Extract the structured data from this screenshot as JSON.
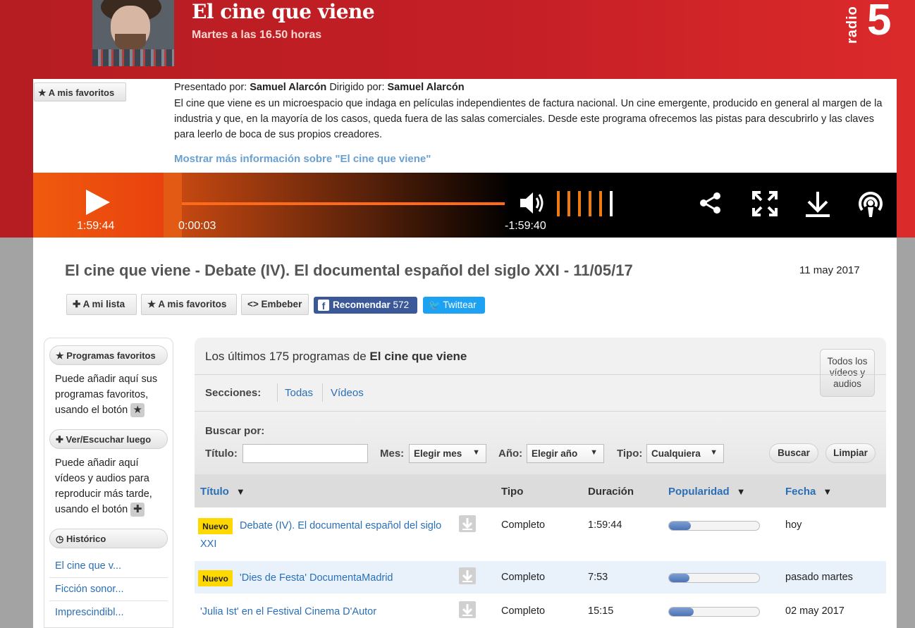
{
  "header": {
    "program_title": "El cine que viene",
    "schedule": "Martes a las 16.50 horas",
    "station_label": "radio",
    "station_number": "5"
  },
  "info": {
    "favorites_button": "A mis favoritos",
    "presented_by_label": "Presentado por:",
    "presenter": "Samuel Alarcón",
    "directed_by_label": "Dirigido por:",
    "director": "Samuel Alarcón",
    "description": "El cine que viene es un microespacio que indaga en películas independientes de factura nacional. Un cine emergente, producido en general al margen de la industria y que, en la mayoría de los casos, queda fuera de las salas comerciales. Desde este programa ofrecemos las pistas para descubrirlo y las claves para leerlo de boca de sus propios creadores.",
    "more_info_link": "Mostrar más información sobre \"El cine que viene\""
  },
  "player": {
    "duration": "1:59:44",
    "elapsed": "0:00:03",
    "remaining": "-1:59:40",
    "progress_fraction": 0.0004,
    "volume_level": 5,
    "volume_steps": 6,
    "accent_color": "#f07a10",
    "icons": [
      "play-icon",
      "volume-icon",
      "share-icon",
      "fullscreen-icon",
      "download-icon",
      "podcast-icon"
    ]
  },
  "episode": {
    "title": "El cine que viene - Debate (IV). El documental español del siglo XXI - 11/05/17",
    "date": "11 may 2017",
    "actions": {
      "my_list": "A mi lista",
      "favorites": "A mis favoritos",
      "embed": "Embeber",
      "recommend": "Recomendar",
      "recommend_count": "572",
      "twitter": "Twittear"
    }
  },
  "sidebar": {
    "favorites_title": "Programas favoritos",
    "favorites_text": "Puede añadir aquí sus programas favoritos, usando el botón",
    "later_title": "Ver/Escuchar luego",
    "later_text": "Puede añadir aquí vídeos y audios para reproducir más tarde, usando el botón",
    "history_title": "Histórico",
    "history_items": [
      "El cine que v...",
      "Ficción sonor...",
      "Imprescindibl..."
    ]
  },
  "listing": {
    "title_prefix": "Los últimos 175 programas de",
    "title_program": "El cine que viene",
    "all_types_button": "Todos los vídeos y audios",
    "sections_label": "Secciones:",
    "sections": [
      "Todas",
      "Vídeos"
    ],
    "search": {
      "search_by_label": "Buscar por:",
      "title_label": "Título:",
      "title_value": "",
      "month_label": "Mes:",
      "month_value": "Elegir mes",
      "year_label": "Año:",
      "year_value": "Elegir año",
      "type_label": "Tipo:",
      "type_value": "Cualquiera",
      "search_button": "Buscar",
      "clear_button": "Limpiar"
    },
    "columns": {
      "title": "Título",
      "type": "Tipo",
      "duration": "Duración",
      "popularity": "Popularidad",
      "date": "Fecha"
    },
    "rows": [
      {
        "badge": "Nuevo",
        "title": "Debate (IV). El documental español del siglo XXI",
        "type": "Completo",
        "duration": "1:59:44",
        "popularity": 0.24,
        "date": "hoy"
      },
      {
        "badge": "Nuevo",
        "title": "'Dies de Festa' DocumentaMadrid",
        "type": "Completo",
        "duration": "7:53",
        "popularity": 0.23,
        "date": "pasado martes"
      },
      {
        "badge": "",
        "title": "'Julia Ist' en el Festival Cinema D'Autor",
        "type": "Completo",
        "duration": "15:15",
        "popularity": 0.27,
        "date": "02 may 2017"
      }
    ]
  }
}
